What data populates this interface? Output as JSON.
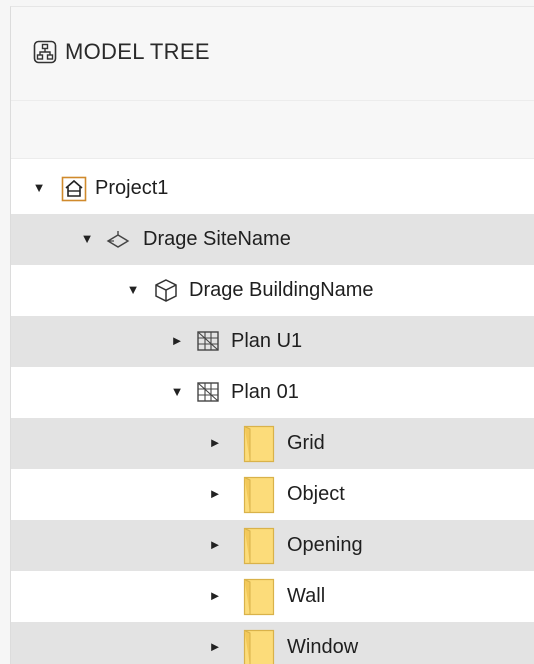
{
  "panel": {
    "title": "MODEL TREE",
    "title_icon": "hierarchy-icon"
  },
  "tree": [
    {
      "label": "Project1",
      "icon": "house-icon",
      "expanded": true,
      "level": 0
    },
    {
      "label": "Drage SiteName",
      "icon": "site-icon",
      "expanded": true,
      "level": 1
    },
    {
      "label": "Drage BuildingName",
      "icon": "building-cube-icon",
      "expanded": true,
      "level": 2
    },
    {
      "label": "Plan U1",
      "icon": "floor-plan-icon",
      "expanded": false,
      "level": 3
    },
    {
      "label": "Plan 01",
      "icon": "floor-plan-icon",
      "expanded": true,
      "level": 3
    },
    {
      "label": "Grid",
      "icon": "folder-icon",
      "expanded": false,
      "level": 4
    },
    {
      "label": "Object",
      "icon": "folder-icon",
      "expanded": false,
      "level": 4
    },
    {
      "label": "Opening",
      "icon": "folder-icon",
      "expanded": false,
      "level": 4
    },
    {
      "label": "Wall",
      "icon": "folder-icon",
      "expanded": false,
      "level": 4
    },
    {
      "label": "Window",
      "icon": "folder-icon",
      "expanded": false,
      "level": 4
    }
  ],
  "colors": {
    "row_alt": "#e3e3e3",
    "folder_fill": "#fcdc7a",
    "folder_stroke": "#d9b24a",
    "project_icon": "#d08a2c"
  }
}
